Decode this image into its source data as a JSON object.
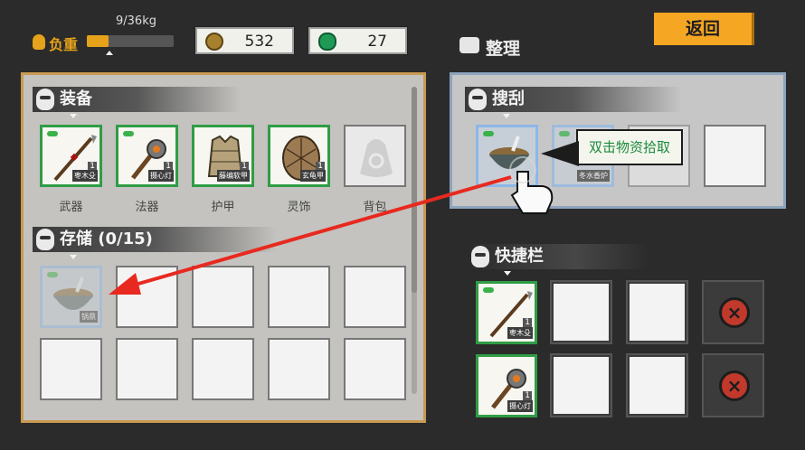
{
  "weight": {
    "label": "负重",
    "current_text": "9/36kg",
    "fill_fraction": 0.25
  },
  "currencies": [
    {
      "name": "gold-coin",
      "value": "532",
      "color": "#a7812e"
    },
    {
      "name": "jade-coin",
      "value": "27",
      "color": "#1f9a56"
    }
  ],
  "tidy": {
    "label": "整理"
  },
  "back_button": {
    "label": "返回"
  },
  "equipment": {
    "title": "装备",
    "slots": [
      {
        "category": "武器",
        "item": "枣木殳",
        "count": "1"
      },
      {
        "category": "法器",
        "item": "摄心灯",
        "count": "1"
      },
      {
        "category": "护甲",
        "item": "藤编软甲",
        "count": "1"
      },
      {
        "category": "灵饰",
        "item": "玄龟甲",
        "count": "1"
      },
      {
        "category": "背包",
        "item": "",
        "count": ""
      }
    ]
  },
  "storage": {
    "title": "存储 (0/15)",
    "first_item_name": "锅鼎"
  },
  "loot": {
    "title": "搜刮",
    "second_item_name": "冬水香炉"
  },
  "tooltip": {
    "text": "双击物资拾取"
  },
  "hotbar": {
    "title": "快捷栏",
    "rows": [
      {
        "item": "枣木殳",
        "count": "1"
      },
      {
        "item": "摄心灯",
        "count": "1"
      }
    ]
  },
  "colors": {
    "accent_orange": "#f5a623",
    "item_border_green": "#2f9d45",
    "hint_arrow_red": "#e8291f",
    "tooltip_text_green": "#1e8a3b"
  }
}
